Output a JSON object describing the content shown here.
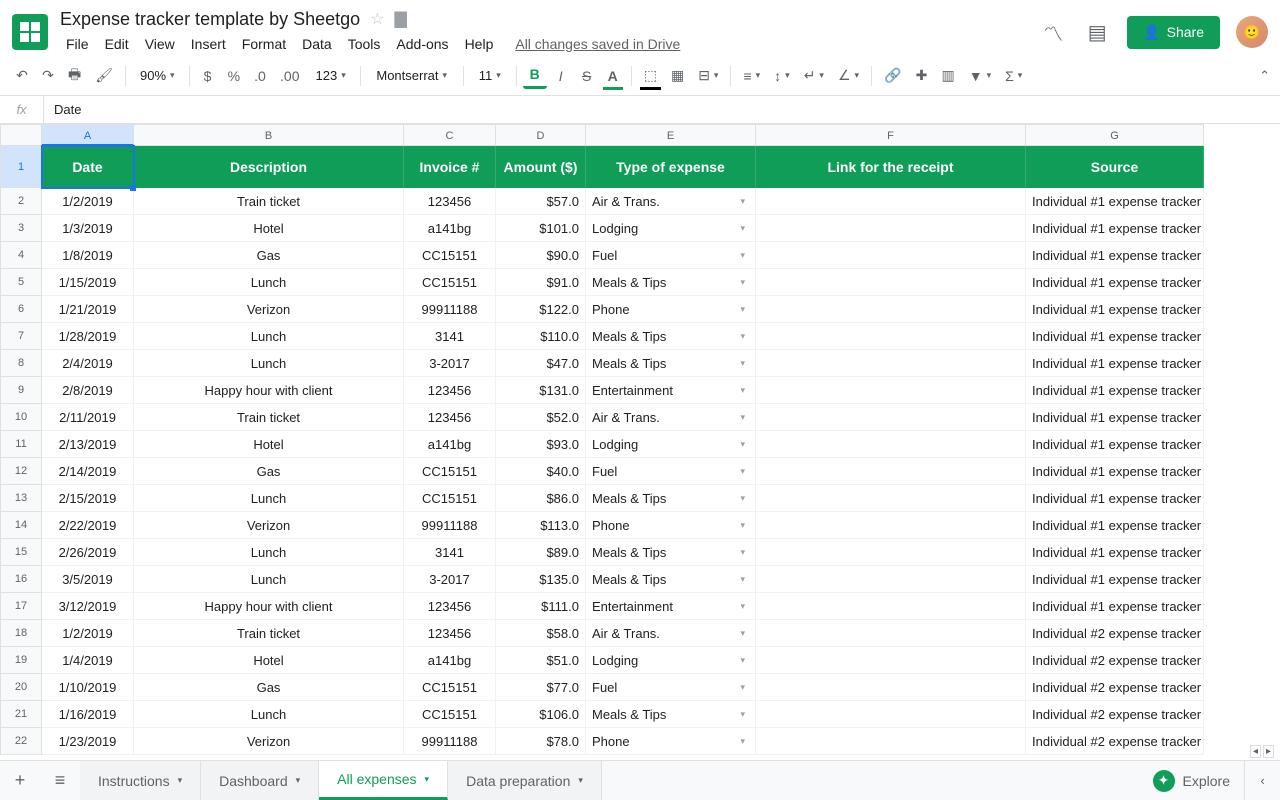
{
  "doc": {
    "title": "Expense tracker template by Sheetgo",
    "saved": "All changes saved in Drive"
  },
  "menu": [
    "File",
    "Edit",
    "View",
    "Insert",
    "Format",
    "Data",
    "Tools",
    "Add-ons",
    "Help"
  ],
  "share": "Share",
  "toolbar": {
    "zoom": "90%",
    "format123": "123",
    "font": "Montserrat",
    "size": "11"
  },
  "formula": {
    "fx": "fx",
    "value": "Date"
  },
  "columns": [
    "A",
    "B",
    "C",
    "D",
    "E",
    "F",
    "G"
  ],
  "headers": [
    "Date",
    "Description",
    "Invoice #",
    "Amount ($)",
    "Type of expense",
    "Link for the receipt",
    "Source"
  ],
  "rows": [
    {
      "n": 2,
      "date": "1/2/2019",
      "desc": "Train ticket",
      "inv": "123456",
      "amt": "$57.0",
      "type": "Air & Trans.",
      "link": "",
      "src": "Individual #1 expense tracker"
    },
    {
      "n": 3,
      "date": "1/3/2019",
      "desc": "Hotel",
      "inv": "a141bg",
      "amt": "$101.0",
      "type": "Lodging",
      "link": "",
      "src": "Individual #1 expense tracker"
    },
    {
      "n": 4,
      "date": "1/8/2019",
      "desc": "Gas",
      "inv": "CC15151",
      "amt": "$90.0",
      "type": "Fuel",
      "link": "",
      "src": "Individual #1 expense tracker"
    },
    {
      "n": 5,
      "date": "1/15/2019",
      "desc": "Lunch",
      "inv": "CC15151",
      "amt": "$91.0",
      "type": "Meals & Tips",
      "link": "",
      "src": "Individual #1 expense tracker"
    },
    {
      "n": 6,
      "date": "1/21/2019",
      "desc": "Verizon",
      "inv": "99911188",
      "amt": "$122.0",
      "type": "Phone",
      "link": "",
      "src": "Individual #1 expense tracker"
    },
    {
      "n": 7,
      "date": "1/28/2019",
      "desc": "Lunch",
      "inv": "3141",
      "amt": "$110.0",
      "type": "Meals & Tips",
      "link": "",
      "src": "Individual #1 expense tracker"
    },
    {
      "n": 8,
      "date": "2/4/2019",
      "desc": "Lunch",
      "inv": "3-2017",
      "amt": "$47.0",
      "type": "Meals & Tips",
      "link": "",
      "src": "Individual #1 expense tracker"
    },
    {
      "n": 9,
      "date": "2/8/2019",
      "desc": "Happy hour with client",
      "inv": "123456",
      "amt": "$131.0",
      "type": "Entertainment",
      "link": "",
      "src": "Individual #1 expense tracker"
    },
    {
      "n": 10,
      "date": "2/11/2019",
      "desc": "Train ticket",
      "inv": "123456",
      "amt": "$52.0",
      "type": "Air & Trans.",
      "link": "",
      "src": "Individual #1 expense tracker"
    },
    {
      "n": 11,
      "date": "2/13/2019",
      "desc": "Hotel",
      "inv": "a141bg",
      "amt": "$93.0",
      "type": "Lodging",
      "link": "",
      "src": "Individual #1 expense tracker"
    },
    {
      "n": 12,
      "date": "2/14/2019",
      "desc": "Gas",
      "inv": "CC15151",
      "amt": "$40.0",
      "type": "Fuel",
      "link": "",
      "src": "Individual #1 expense tracker"
    },
    {
      "n": 13,
      "date": "2/15/2019",
      "desc": "Lunch",
      "inv": "CC15151",
      "amt": "$86.0",
      "type": "Meals & Tips",
      "link": "",
      "src": "Individual #1 expense tracker"
    },
    {
      "n": 14,
      "date": "2/22/2019",
      "desc": "Verizon",
      "inv": "99911188",
      "amt": "$113.0",
      "type": "Phone",
      "link": "",
      "src": "Individual #1 expense tracker"
    },
    {
      "n": 15,
      "date": "2/26/2019",
      "desc": "Lunch",
      "inv": "3141",
      "amt": "$89.0",
      "type": "Meals & Tips",
      "link": "",
      "src": "Individual #1 expense tracker"
    },
    {
      "n": 16,
      "date": "3/5/2019",
      "desc": "Lunch",
      "inv": "3-2017",
      "amt": "$135.0",
      "type": "Meals & Tips",
      "link": "",
      "src": "Individual #1 expense tracker"
    },
    {
      "n": 17,
      "date": "3/12/2019",
      "desc": "Happy hour with client",
      "inv": "123456",
      "amt": "$111.0",
      "type": "Entertainment",
      "link": "",
      "src": "Individual #1 expense tracker"
    },
    {
      "n": 18,
      "date": "1/2/2019",
      "desc": "Train ticket",
      "inv": "123456",
      "amt": "$58.0",
      "type": "Air & Trans.",
      "link": "",
      "src": "Individual #2 expense tracker"
    },
    {
      "n": 19,
      "date": "1/4/2019",
      "desc": "Hotel",
      "inv": "a141bg",
      "amt": "$51.0",
      "type": "Lodging",
      "link": "",
      "src": "Individual #2 expense tracker"
    },
    {
      "n": 20,
      "date": "1/10/2019",
      "desc": "Gas",
      "inv": "CC15151",
      "amt": "$77.0",
      "type": "Fuel",
      "link": "",
      "src": "Individual #2 expense tracker"
    },
    {
      "n": 21,
      "date": "1/16/2019",
      "desc": "Lunch",
      "inv": "CC15151",
      "amt": "$106.0",
      "type": "Meals & Tips",
      "link": "",
      "src": "Individual #2 expense tracker"
    },
    {
      "n": 22,
      "date": "1/23/2019",
      "desc": "Verizon",
      "inv": "99911188",
      "amt": "$78.0",
      "type": "Phone",
      "link": "",
      "src": "Individual #2 expense tracker"
    }
  ],
  "tabs": [
    {
      "label": "Instructions",
      "active": false
    },
    {
      "label": "Dashboard",
      "active": false
    },
    {
      "label": "All expenses",
      "active": true
    },
    {
      "label": "Data preparation",
      "active": false
    }
  ],
  "explore": "Explore"
}
